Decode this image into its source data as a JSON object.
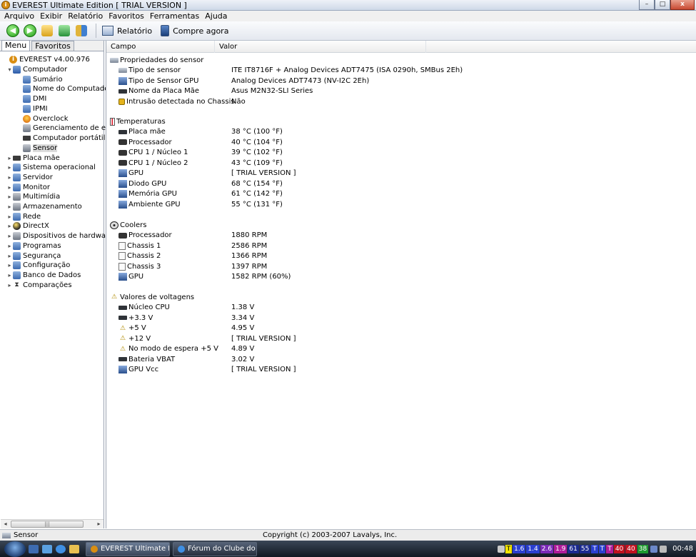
{
  "window": {
    "title": "EVEREST Ultimate Edition  [ TRIAL VERSION ]",
    "minimize_glyph": "–",
    "maximize_glyph": "□",
    "close_glyph": "x"
  },
  "menubar": [
    "Arquivo",
    "Exibir",
    "Relatório",
    "Favoritos",
    "Ferramentas",
    "Ajuda"
  ],
  "toolbar": {
    "back_glyph": "◀",
    "forward_glyph": "▶",
    "report_label": "Relatório",
    "buy_label": "Compre agora"
  },
  "left_tabs": [
    "Menu",
    "Favoritos"
  ],
  "tree": [
    {
      "label": "EVEREST v4.00.976",
      "icon": "everest-icon",
      "glyph": "i",
      "cls": "ico-info",
      "exp": ""
    },
    {
      "label": "Computador",
      "icon": "computer-icon",
      "glyph": "",
      "cls": "ico-pc",
      "exp": "▾"
    },
    {
      "label": "Sumário",
      "icon": "summary-icon",
      "glyph": "",
      "cls": "ico-gen",
      "exp": ""
    },
    {
      "label": "Nome do Computador",
      "icon": "computer-name-icon",
      "glyph": "",
      "cls": "ico-gen",
      "exp": ""
    },
    {
      "label": "DMI",
      "icon": "dmi-icon",
      "glyph": "",
      "cls": "ico-gen",
      "exp": ""
    },
    {
      "label": "IPMI",
      "icon": "ipmi-icon",
      "glyph": "",
      "cls": "ico-gen",
      "exp": ""
    },
    {
      "label": "Overclock",
      "icon": "overclock-icon",
      "glyph": "",
      "cls": "ico-fire",
      "exp": ""
    },
    {
      "label": "Gerenciamento de ene",
      "icon": "power-management-icon",
      "glyph": "",
      "cls": "ico-gray",
      "exp": ""
    },
    {
      "label": "Computador portátil",
      "icon": "laptop-icon",
      "glyph": "",
      "cls": "ico-chip",
      "exp": ""
    },
    {
      "label": "Sensor",
      "icon": "sensor-icon",
      "glyph": "",
      "cls": "ico-gray",
      "exp": ""
    },
    {
      "label": "Placa mãe",
      "icon": "motherboard-icon",
      "glyph": "",
      "cls": "ico-chip",
      "exp": "▸"
    },
    {
      "label": "Sistema operacional",
      "icon": "os-icon",
      "glyph": "",
      "cls": "ico-gen",
      "exp": "▸"
    },
    {
      "label": "Servidor",
      "icon": "server-icon",
      "glyph": "",
      "cls": "ico-gen",
      "exp": "▸"
    },
    {
      "label": "Monitor",
      "icon": "monitor-icon",
      "glyph": "",
      "cls": "ico-gen",
      "exp": "▸"
    },
    {
      "label": "Multimídia",
      "icon": "multimedia-icon",
      "glyph": "",
      "cls": "ico-gray",
      "exp": "▸"
    },
    {
      "label": "Armazenamento",
      "icon": "storage-icon",
      "glyph": "",
      "cls": "ico-gray",
      "exp": "▸"
    },
    {
      "label": "Rede",
      "icon": "network-icon",
      "glyph": "",
      "cls": "ico-gen",
      "exp": "▸"
    },
    {
      "label": "DirectX",
      "icon": "directx-icon",
      "glyph": "",
      "cls": "ico-dx",
      "exp": "▸"
    },
    {
      "label": "Dispositivos de hardware",
      "icon": "devices-icon",
      "glyph": "",
      "cls": "ico-gray",
      "exp": "▸"
    },
    {
      "label": "Programas",
      "icon": "programs-icon",
      "glyph": "",
      "cls": "ico-gen",
      "exp": "▸"
    },
    {
      "label": "Segurança",
      "icon": "security-icon",
      "glyph": "",
      "cls": "ico-gen",
      "exp": "▸"
    },
    {
      "label": "Configuração",
      "icon": "configuration-icon",
      "glyph": "",
      "cls": "ico-gen",
      "exp": "▸"
    },
    {
      "label": "Banco de Dados",
      "icon": "database-icon",
      "glyph": "",
      "cls": "ico-gen",
      "exp": "▸"
    },
    {
      "label": "Comparações",
      "icon": "benchmark-icon",
      "glyph": "⧗",
      "cls": "ico-hg",
      "exp": "▸"
    }
  ],
  "selected_tree_item": "Sensor",
  "left_scroll": {
    "left": "◂",
    "right": "▸",
    "grip": "|||"
  },
  "columns": {
    "field": "Campo",
    "value": "Valor"
  },
  "sections": [
    {
      "title": "Propriedades do sensor",
      "icon": "sensor-properties-icon",
      "cls": "ico-sensor",
      "glyph": "",
      "rows": [
        {
          "field": "Tipo de sensor",
          "value": "ITE IT8716F + Analog Devices ADT7475  (ISA 0290h, SMBus 2Eh)",
          "icon": "sensor-type-icon",
          "cls": "ico-sensor",
          "glyph": ""
        },
        {
          "field": "Tipo de Sensor GPU",
          "value": "Analog Devices ADT7473  (NV-I2C 2Eh)",
          "icon": "gpu-sensor-icon",
          "cls": "ico-gpu",
          "glyph": ""
        },
        {
          "field": "Nome da Placa Mãe",
          "value": "Asus M2N32-SLI Series",
          "icon": "motherboard-icon",
          "cls": "ico-mb",
          "glyph": ""
        },
        {
          "field": "Intrusão detectada no Chassis",
          "value": "Não",
          "icon": "lock-icon",
          "cls": "ico-lock",
          "glyph": ""
        }
      ]
    },
    {
      "title": "Temperaturas",
      "icon": "thermometer-icon",
      "cls": "ico-therm",
      "glyph": "",
      "rows": [
        {
          "field": "Placa mãe",
          "value": "38 °C  (100 °F)",
          "icon": "motherboard-icon",
          "cls": "ico-mb",
          "glyph": ""
        },
        {
          "field": "Processador",
          "value": "40 °C  (104 °F)",
          "icon": "cpu-icon",
          "cls": "ico-cpu",
          "glyph": ""
        },
        {
          "field": "CPU 1 / Núcleo 1",
          "value": "39 °C  (102 °F)",
          "icon": "cpu-icon",
          "cls": "ico-cpu",
          "glyph": ""
        },
        {
          "field": "CPU 1 / Núcleo 2",
          "value": "43 °C  (109 °F)",
          "icon": "cpu-icon",
          "cls": "ico-cpu",
          "glyph": ""
        },
        {
          "field": "GPU",
          "value": "[ TRIAL VERSION ]",
          "icon": "gpu-icon",
          "cls": "ico-gpu",
          "glyph": ""
        },
        {
          "field": "Diodo GPU",
          "value": "68 °C  (154 °F)",
          "icon": "gpu-icon",
          "cls": "ico-gpu",
          "glyph": ""
        },
        {
          "field": "Memória GPU",
          "value": "61 °C  (142 °F)",
          "icon": "gpu-memory-icon",
          "cls": "ico-gpu",
          "glyph": ""
        },
        {
          "field": "Ambiente GPU",
          "value": "55 °C  (131 °F)",
          "icon": "gpu-icon",
          "cls": "ico-gpu",
          "glyph": ""
        }
      ]
    },
    {
      "title": "Coolers",
      "icon": "fan-icon",
      "cls": "ico-fan",
      "glyph": "",
      "rows": [
        {
          "field": "Processador",
          "value": "1880 RPM",
          "icon": "cpu-icon",
          "cls": "ico-cpu",
          "glyph": ""
        },
        {
          "field": "Chassis 1",
          "value": "2586 RPM",
          "icon": "chassis-icon",
          "cls": "ico-chassis",
          "glyph": ""
        },
        {
          "field": "Chassis 2",
          "value": "1366 RPM",
          "icon": "chassis-icon",
          "cls": "ico-chassis",
          "glyph": ""
        },
        {
          "field": "Chassis 3",
          "value": "1397 RPM",
          "icon": "chassis-icon",
          "cls": "ico-chassis",
          "glyph": ""
        },
        {
          "field": "GPU",
          "value": "1582 RPM  (60%)",
          "icon": "gpu-icon",
          "cls": "ico-gpu",
          "glyph": ""
        }
      ]
    },
    {
      "title": "Valores de voltagens",
      "icon": "warning-icon",
      "cls": "ico-warn",
      "glyph": "⚠",
      "rows": [
        {
          "field": "Núcleo CPU",
          "value": "1.38 V",
          "icon": "cpu-icon",
          "cls": "ico-volt",
          "glyph": ""
        },
        {
          "field": "+3.3 V",
          "value": "3.34 V",
          "icon": "voltage-icon",
          "cls": "ico-volt",
          "glyph": ""
        },
        {
          "field": "+5 V",
          "value": "4.95 V",
          "icon": "warning-icon",
          "cls": "ico-warn",
          "glyph": "⚠"
        },
        {
          "field": "+12 V",
          "value": "[ TRIAL VERSION ]",
          "icon": "warning-icon",
          "cls": "ico-warn",
          "glyph": "⚠"
        },
        {
          "field": "No modo de espera +5 V",
          "value": "4.89 V",
          "icon": "warning-icon",
          "cls": "ico-warn",
          "glyph": "⚠"
        },
        {
          "field": "Bateria VBAT",
          "value": "3.02 V",
          "icon": "battery-icon",
          "cls": "ico-volt",
          "glyph": ""
        },
        {
          "field": "GPU Vcc",
          "value": "[ TRIAL VERSION ]",
          "icon": "gpu-icon",
          "cls": "ico-gpu",
          "glyph": ""
        }
      ]
    }
  ],
  "statusbar": {
    "left": "Sensor",
    "right": "Copyright (c) 2003-2007 Lavalys, Inc."
  },
  "taskbar": {
    "buttons": [
      "EVEREST Ultimate E...",
      "Fórum do Clube do ..."
    ],
    "tray_items": [
      {
        "text": "T",
        "bg": "#f2e400",
        "fg": "#000"
      },
      {
        "text": "1.6",
        "bg": "#2a3fd0",
        "fg": "#fff"
      },
      {
        "text": "1.4",
        "bg": "#2a3fd0",
        "fg": "#fff"
      },
      {
        "text": "2.6",
        "bg": "#7b2ab8",
        "fg": "#fff"
      },
      {
        "text": "1.9",
        "bg": "#b01c9a",
        "fg": "#fff"
      },
      {
        "text": "61",
        "bg": "#1b2a8f",
        "fg": "#fff"
      },
      {
        "text": "55",
        "bg": "#1b2a8f",
        "fg": "#fff"
      },
      {
        "text": "T",
        "bg": "#2a3fd0",
        "fg": "#fff"
      },
      {
        "text": "T",
        "bg": "#2a3fd0",
        "fg": "#fff"
      },
      {
        "text": "T",
        "bg": "#b01c9a",
        "fg": "#fff"
      },
      {
        "text": "40",
        "bg": "#c1121f",
        "fg": "#fff"
      },
      {
        "text": "40",
        "bg": "#c1121f",
        "fg": "#fff"
      },
      {
        "text": "38",
        "bg": "#1f9a2f",
        "fg": "#fff"
      }
    ],
    "clock": "00:48"
  }
}
